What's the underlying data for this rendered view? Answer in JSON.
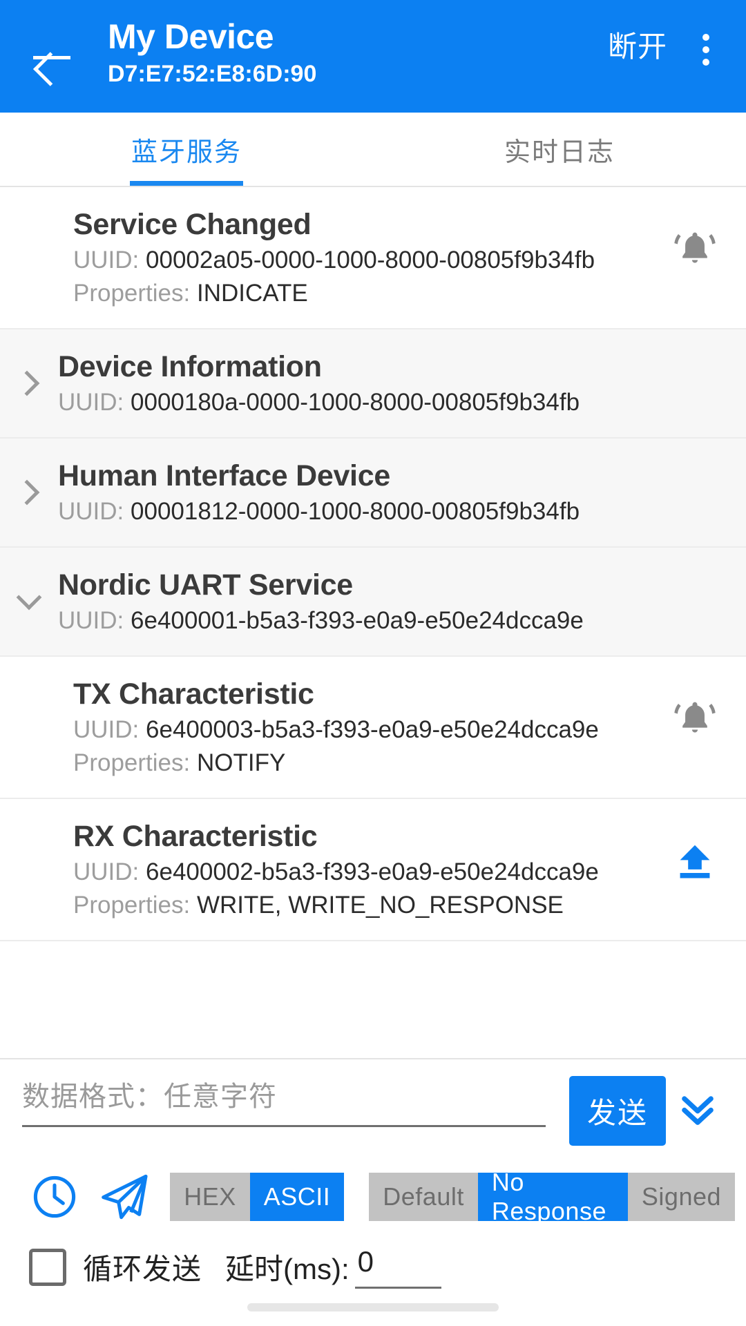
{
  "appbar": {
    "back_icon": "arrow-left-icon",
    "title": "My Device",
    "subtitle": "D7:E7:52:E8:6D:90",
    "disconnect_label": "断开",
    "overflow_icon": "more-vertical-icon",
    "background_color": "#0C80F2"
  },
  "tabs": [
    {
      "label": "蓝牙服务",
      "active": true
    },
    {
      "label": "实时日志",
      "active": false
    }
  ],
  "accent_color": "#0C80F2",
  "services": [
    {
      "name": "service-changed",
      "title": "Service Changed",
      "uuid_label": "UUID:",
      "uuid": "00002a05-0000-1000-8000-00805f9b34fb",
      "properties_label": "Properties:",
      "properties": "INDICATE",
      "icon": "bell-ring-icon",
      "icon_color": "#8A8A8A",
      "expander": "none",
      "shaded": false
    },
    {
      "name": "device-information",
      "title": "Device Information",
      "uuid_label": "UUID:",
      "uuid": "0000180a-0000-1000-8000-00805f9b34fb",
      "properties_label": "",
      "properties": "",
      "icon": "none",
      "icon_color": "",
      "expander": "chevron-right-icon",
      "shaded": true
    },
    {
      "name": "human-interface-device",
      "title": "Human Interface Device",
      "uuid_label": "UUID:",
      "uuid": "00001812-0000-1000-8000-00805f9b34fb",
      "properties_label": "",
      "properties": "",
      "icon": "none",
      "icon_color": "",
      "expander": "chevron-right-icon",
      "shaded": true
    },
    {
      "name": "nordic-uart-service",
      "title": "Nordic UART Service",
      "uuid_label": "UUID:",
      "uuid": "6e400001-b5a3-f393-e0a9-e50e24dcca9e",
      "properties_label": "",
      "properties": "",
      "icon": "none",
      "icon_color": "",
      "expander": "chevron-down-icon",
      "shaded": true
    },
    {
      "name": "tx-characteristic",
      "title": "TX Characteristic",
      "uuid_label": "UUID:",
      "uuid": "6e400003-b5a3-f393-e0a9-e50e24dcca9e",
      "properties_label": "Properties:",
      "properties": "NOTIFY",
      "icon": "bell-ring-icon",
      "icon_color": "#8A8A8A",
      "expander": "none",
      "shaded": false
    },
    {
      "name": "rx-characteristic",
      "title": "RX Characteristic",
      "uuid_label": "UUID:",
      "uuid": "6e400002-b5a3-f393-e0a9-e50e24dcca9e",
      "properties_label": "Properties:",
      "properties": "WRITE, WRITE_NO_RESPONSE",
      "icon": "upload-icon",
      "icon_color": "#0C80F2",
      "expander": "none",
      "shaded": false
    }
  ],
  "send_bar": {
    "input_value": "",
    "input_placeholder": "数据格式：任意字符",
    "send_label": "发送",
    "expand_icon": "chevron-double-down-icon"
  },
  "options": {
    "history_icon": "clock-icon",
    "quick_send_icon": "paper-plane-icon",
    "format": {
      "options": [
        "HEX",
        "ASCII"
      ],
      "selected": "ASCII"
    },
    "write_mode": {
      "options": [
        "Default",
        "No Response",
        "Signed"
      ],
      "selected": "No Response"
    }
  },
  "loop_row": {
    "checkbox_checked": false,
    "loop_label": "循环发送",
    "delay_label": "延时(ms):",
    "delay_value": "0"
  }
}
